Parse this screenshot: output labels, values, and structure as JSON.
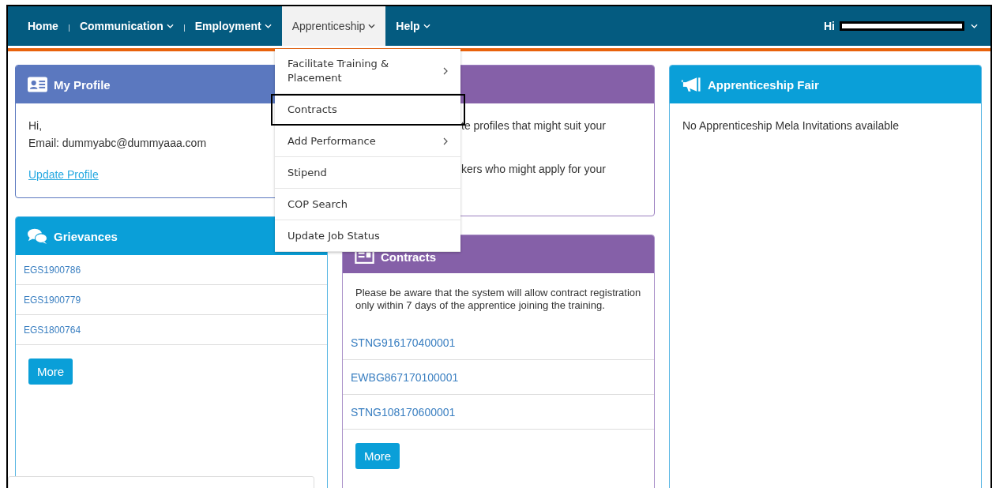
{
  "nav": {
    "items": [
      {
        "label": "Home",
        "dropdown": false,
        "selected": false
      },
      {
        "label": "Communication",
        "dropdown": true,
        "selected": false
      },
      {
        "label": "Employment",
        "dropdown": true,
        "selected": false
      },
      {
        "label": "Apprenticeship",
        "dropdown": true,
        "selected": true
      },
      {
        "label": "Help",
        "dropdown": true,
        "selected": false
      }
    ],
    "user_greeting": "Hi"
  },
  "menu": {
    "items": [
      {
        "label": "Facilitate Training & Placement",
        "submenu": true,
        "selected": false
      },
      {
        "label": "Contracts",
        "submenu": false,
        "selected": true
      },
      {
        "label": "Add Performance",
        "submenu": true,
        "selected": false
      },
      {
        "label": "Stipend",
        "submenu": false,
        "selected": false
      },
      {
        "label": "COP Search",
        "submenu": false,
        "selected": false
      },
      {
        "label": "Update Job Status",
        "submenu": false,
        "selected": false
      }
    ]
  },
  "profile": {
    "title": "My Profile",
    "greeting": "Hi,",
    "email": "Email: dummyabc@dummyaaa.com",
    "link": "Update Profile"
  },
  "middle_card": {
    "lines": [
      "te profiles that might suit your",
      "kers who might apply for your"
    ]
  },
  "grievances": {
    "title": "Grievances",
    "items": [
      "EGS1900786",
      "EGS1900779",
      "EGS1800764"
    ],
    "button": "More"
  },
  "contracts": {
    "title": "Contracts",
    "notice": "Please be aware that the system will allow contract registration only within 7 days of the apprentice joining the training.",
    "items": [
      "STNG916170400001",
      "EWBG867170100001",
      "STNG108170600001"
    ],
    "button": "More"
  },
  "fair": {
    "title": "Apprenticeship Fair",
    "message": "No Apprenticeship Mela Invitations available"
  }
}
